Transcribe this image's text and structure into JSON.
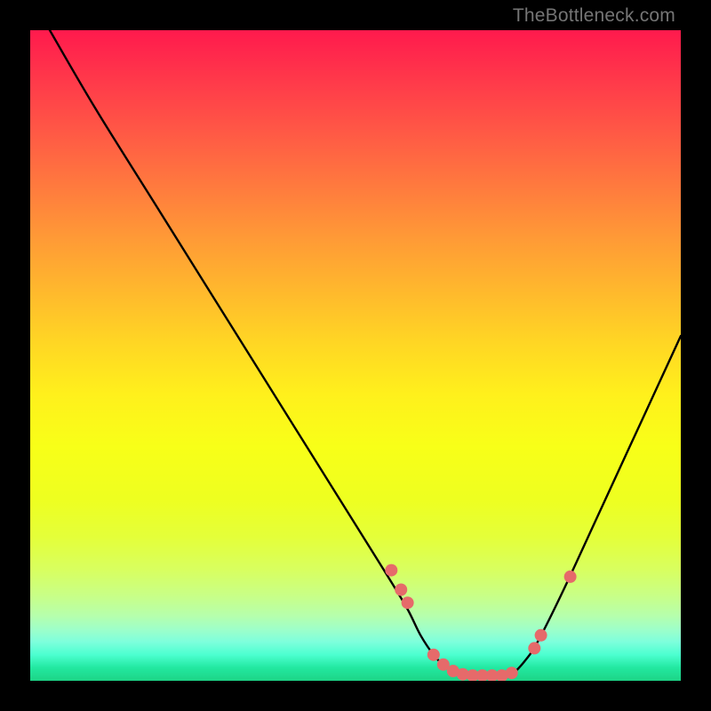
{
  "attribution": "TheBottleneck.com",
  "chart_data": {
    "type": "line",
    "title": "",
    "xlabel": "",
    "ylabel": "",
    "xlim": [
      0,
      100
    ],
    "ylim": [
      0,
      100
    ],
    "series": [
      {
        "name": "curve",
        "x": [
          3,
          10,
          20,
          30,
          40,
          50,
          55,
          58,
          60,
          62,
          64,
          66,
          68,
          70,
          72,
          74,
          76,
          78,
          82,
          88,
          94,
          100
        ],
        "y": [
          100,
          88,
          72,
          56,
          40,
          24,
          16,
          11,
          7,
          4,
          2,
          1,
          0.5,
          0.5,
          0.5,
          1,
          3,
          6,
          14,
          27,
          40,
          53
        ]
      }
    ],
    "markers": {
      "x": [
        55.5,
        57.0,
        58.0,
        62.0,
        63.5,
        65.0,
        66.5,
        68.0,
        69.5,
        71.0,
        72.5,
        74.0,
        77.5,
        78.5,
        83.0
      ],
      "y": [
        17.0,
        14.0,
        12.0,
        4.0,
        2.5,
        1.5,
        1.0,
        0.8,
        0.8,
        0.8,
        0.8,
        1.2,
        5.0,
        7.0,
        16.0
      ],
      "color": "#e66a6a",
      "radius": 7
    },
    "gradient_stops": [
      {
        "pos": 0,
        "color": "#ff1a4d"
      },
      {
        "pos": 50,
        "color": "#ffe020"
      },
      {
        "pos": 100,
        "color": "#1dd486"
      }
    ]
  }
}
